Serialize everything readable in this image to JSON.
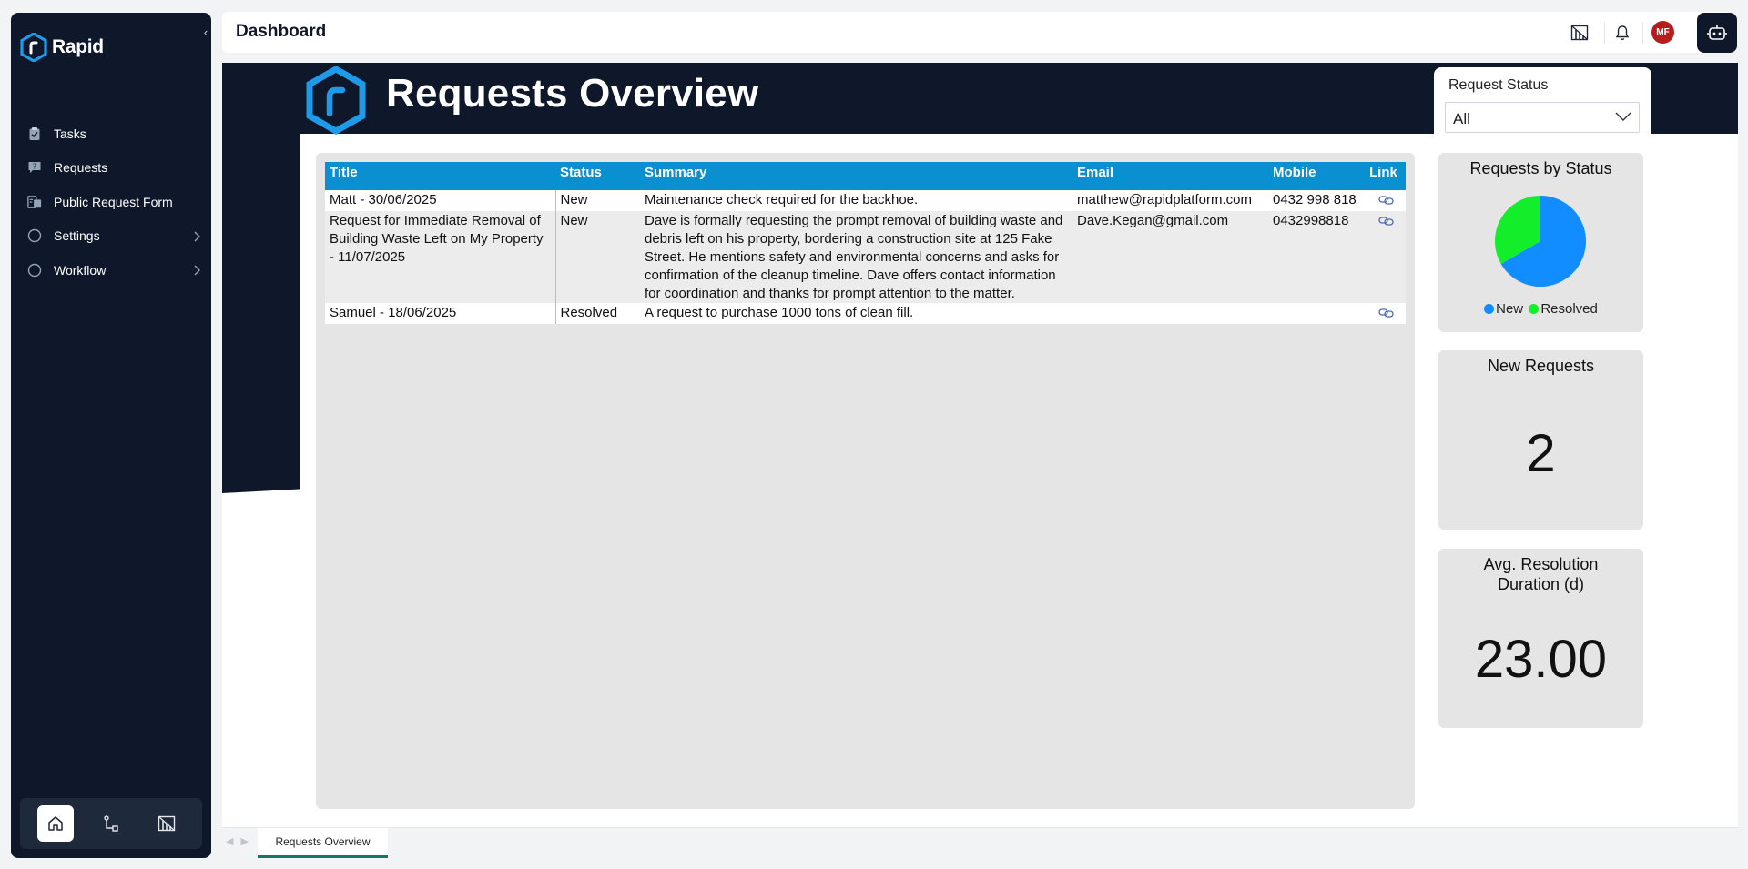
{
  "app": {
    "name": "Rapid"
  },
  "sidebar": {
    "items": [
      {
        "label": "Tasks",
        "icon": "clipboard-icon"
      },
      {
        "label": "Requests",
        "icon": "chat-question-icon"
      },
      {
        "label": "Public Request Form",
        "icon": "form-icon"
      },
      {
        "label": "Settings",
        "icon": "circle-icon",
        "expandable": true
      },
      {
        "label": "Workflow",
        "icon": "circle-icon",
        "expandable": true
      }
    ],
    "bottom": [
      "home-icon",
      "flow-icon",
      "powerbi-icon"
    ]
  },
  "header": {
    "title": "Dashboard",
    "avatar_initials": "MF"
  },
  "report": {
    "title": "Requests Overview",
    "slicer": {
      "label": "Request Status",
      "value": "All"
    },
    "table": {
      "columns": [
        "Title",
        "Status",
        "Summary",
        "Email",
        "Mobile",
        "Link"
      ],
      "rows": [
        {
          "title": "Matt - 30/06/2025",
          "status": "New",
          "summary": "Maintenance check required for the backhoe.",
          "email": "matthew@rapidplatform.com",
          "mobile": "0432 998 818"
        },
        {
          "title": "Request for Immediate Removal of Building Waste Left on My Property - 11/07/2025",
          "status": "New",
          "summary": "Dave is formally requesting the prompt removal of building waste and debris left on his property, bordering a construction site at 125 Fake Street. He mentions safety and environmental concerns and asks for confirmation of the cleanup timeline. Dave offers contact information for coordination and thanks for prompt attention to the matter.",
          "email": "Dave.Kegan@gmail.com",
          "mobile": "0432998818"
        },
        {
          "title": "Samuel - 18/06/2025",
          "status": "Resolved",
          "summary": "A request to purchase 1000 tons of clean fill.",
          "email": "",
          "mobile": ""
        }
      ]
    },
    "status_chart": {
      "title": "Requests by Status",
      "legend": [
        "New",
        "Resolved"
      ]
    },
    "new_requests": {
      "title": "New Requests",
      "value": "2"
    },
    "avg_resolution": {
      "title": "Avg. Resolution Duration (d)",
      "value": "23.00"
    },
    "tabs": [
      "Requests Overview"
    ]
  },
  "chart_data": {
    "type": "pie",
    "title": "Requests by Status",
    "categories": [
      "New",
      "Resolved"
    ],
    "values": [
      2,
      1
    ],
    "colors": [
      "#118dff",
      "#12ef2a"
    ],
    "legend": "bottom"
  },
  "colors": {
    "sidebar_bg": "#0f172a",
    "table_header": "#0a8fd1",
    "new": "#118dff",
    "resolved": "#12ef2a",
    "active_tab_underline": "#117865"
  }
}
